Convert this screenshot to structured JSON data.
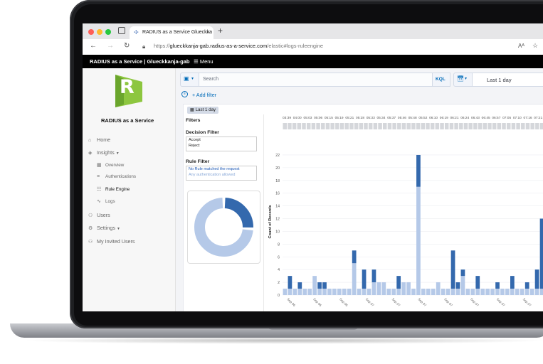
{
  "browser": {
    "tab_title": "RADIUS as a Service Glueckka",
    "url_prefix": "https://",
    "url_host": "glueckkanja-gab.radius-as-a-service.com",
    "url_path": "/elastic#logs-ruleengine"
  },
  "app_header": {
    "title": "RADIUS as a Service | Glueckkanja-gab",
    "menu_label": "Menu"
  },
  "sidebar": {
    "brand_letter": "R",
    "brand_name": "RADIUS as a Service",
    "items": [
      {
        "label": "Home",
        "icon": "home-icon"
      },
      {
        "label": "Insights",
        "icon": "layers-icon"
      },
      {
        "label": "Overview",
        "icon": "grid-icon"
      },
      {
        "label": "Authentications",
        "icon": "list-icon"
      },
      {
        "label": "Rule Engine",
        "icon": "rules-icon"
      },
      {
        "label": "Logs",
        "icon": "pulse-icon"
      },
      {
        "label": "Users",
        "icon": "users-icon"
      },
      {
        "label": "Settings",
        "icon": "gear-icon"
      },
      {
        "label": "My Invited Users",
        "icon": "users-icon"
      }
    ]
  },
  "search": {
    "placeholder": "Search",
    "kql_label": "KQL",
    "date_range": "Last 1 day",
    "add_filter": "+ Add filter"
  },
  "panel": {
    "badge": "Last 1 day",
    "filters_title": "Filters",
    "decision_filter_label": "Decision Filter",
    "decision_options": [
      "Accept",
      "Reject"
    ],
    "rule_filter_label": "Rule Filter",
    "rule_options": [
      "No Rule matched the request",
      "Any authentication allowed"
    ]
  },
  "donut": {
    "segments": [
      {
        "name": "No Rule matched the request",
        "fraction": 0.26,
        "color": "#3469ad"
      },
      {
        "name": "Any authentication allowed",
        "fraction": 0.74,
        "color": "#b5c9e8"
      }
    ]
  },
  "colors": {
    "accent": "#006bb8",
    "bar_light": "#b5c9e8",
    "bar_dark": "#3469ad",
    "brand_green": "#8dc63f"
  },
  "chart_data": {
    "type": "bar",
    "stacked": true,
    "time_labels": [
      "03:39",
      "04:00",
      "05:03",
      "05:06",
      "05:15",
      "05:19",
      "05:21",
      "05:28",
      "05:33",
      "05:34",
      "05:37",
      "05:46",
      "05:48",
      "05:52",
      "06:10",
      "06:19",
      "06:21",
      "06:24",
      "06:43",
      "06:45",
      "06:57",
      "07:05",
      "07:10",
      "07:16",
      "07:21"
    ],
    "ylabel": "Count of Records",
    "yticks": [
      0,
      2,
      4,
      6,
      8,
      10,
      12,
      14,
      16,
      18,
      20,
      22
    ],
    "ylim": [
      0,
      23
    ],
    "x_tick_labels": [
      "Sep 06",
      "Sep 06",
      "Sep 06",
      "Sep 07",
      "Sep 07",
      "Sep 07",
      "Sep 07",
      "Sep 07",
      "Sep 07",
      "Sep 07"
    ],
    "series": [
      {
        "name": "Any authentication allowed",
        "values": [
          1,
          1,
          1,
          1,
          1,
          1,
          3,
          1,
          1,
          1,
          1,
          1,
          1,
          1,
          5,
          1,
          1,
          1,
          2,
          2,
          2,
          1,
          1,
          1,
          2,
          2,
          1,
          17,
          1,
          1,
          1,
          2,
          1,
          1,
          1,
          1,
          3,
          1,
          1,
          1,
          1,
          1,
          1,
          1,
          1,
          1,
          1,
          1,
          1,
          1,
          1,
          1,
          1
        ]
      },
      {
        "name": "No Rule matched the request",
        "values": [
          0,
          2,
          0,
          1,
          0,
          0,
          0,
          1,
          1,
          0,
          0,
          0,
          0,
          0,
          2,
          0,
          3,
          0,
          2,
          0,
          0,
          0,
          0,
          2,
          0,
          0,
          0,
          5,
          0,
          0,
          0,
          0,
          0,
          0,
          6,
          1,
          1,
          0,
          0,
          2,
          0,
          0,
          0,
          1,
          0,
          0,
          2,
          0,
          0,
          1,
          0,
          3,
          11
        ]
      }
    ]
  }
}
